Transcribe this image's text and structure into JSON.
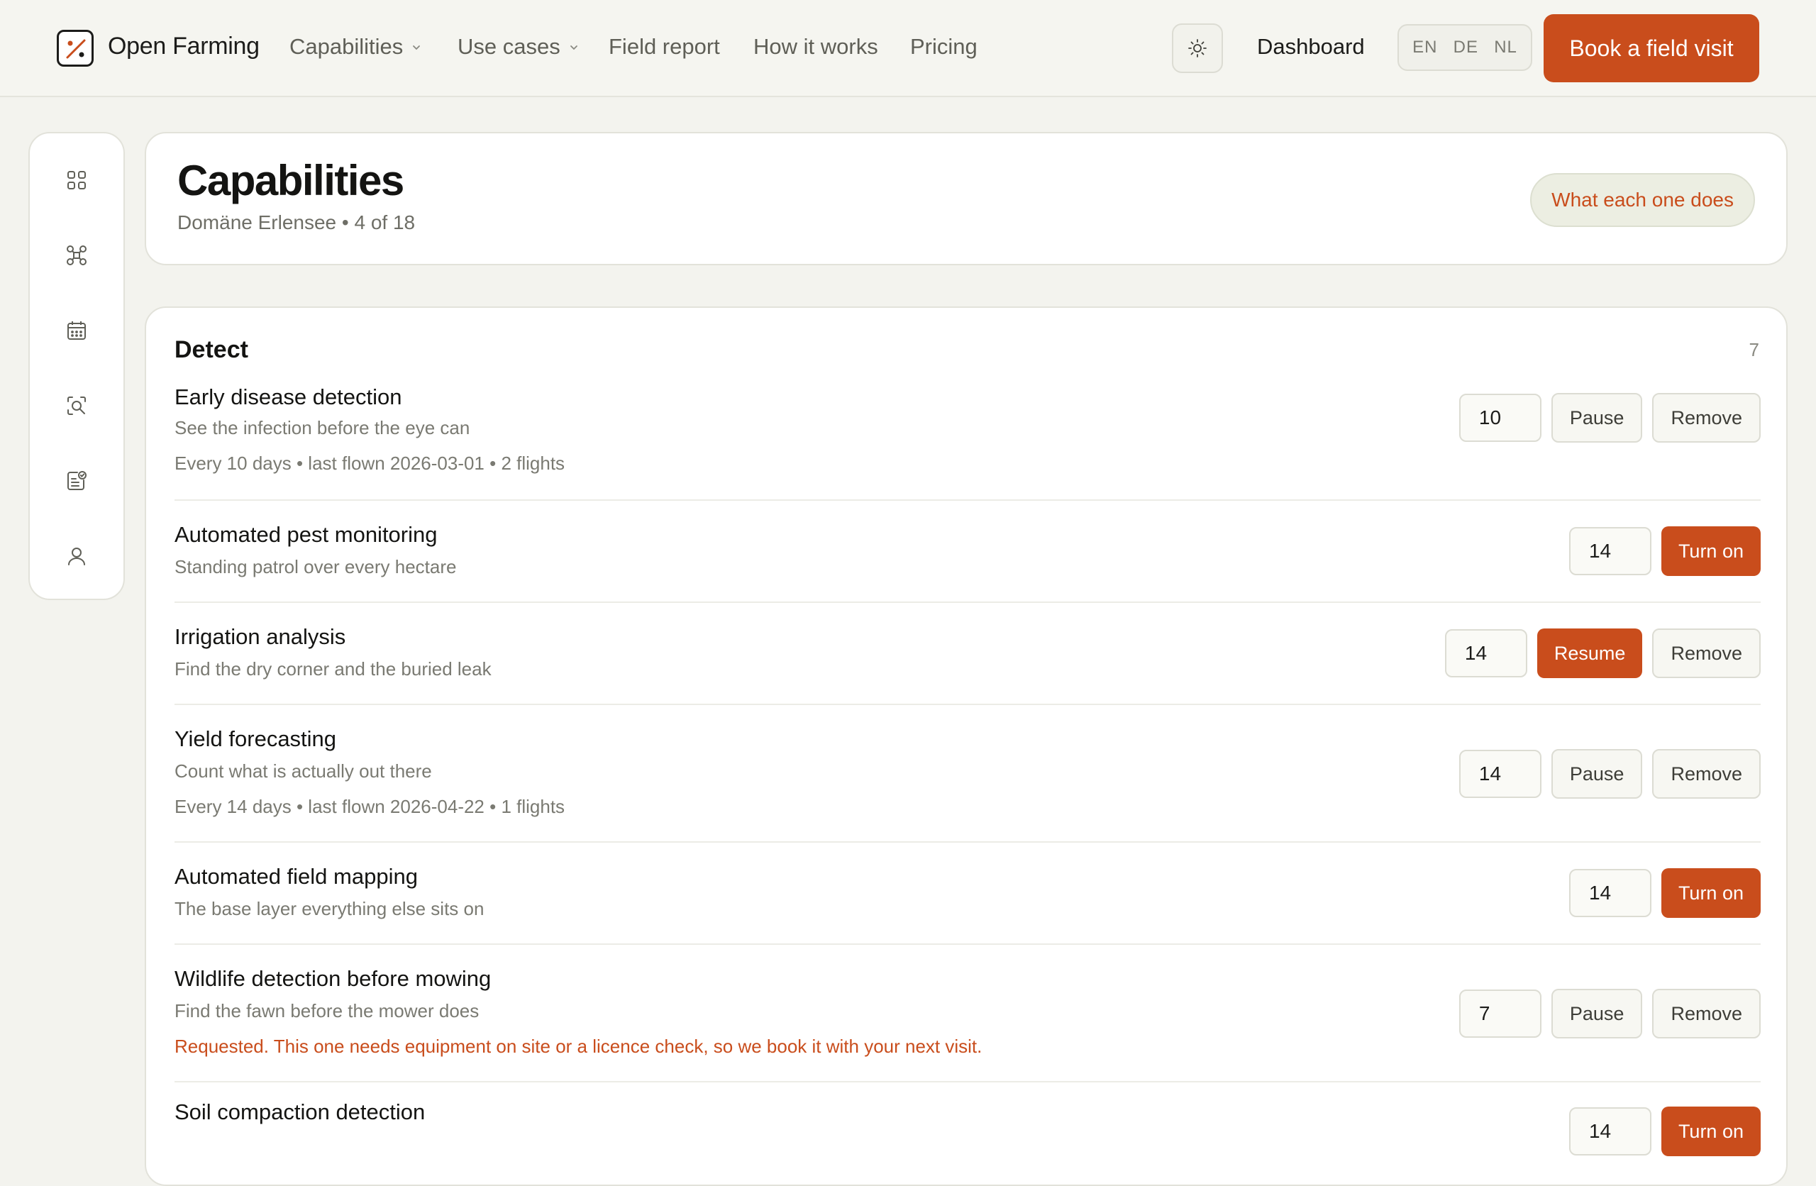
{
  "header": {
    "brand": "Open Farming",
    "nav": [
      {
        "label": "Capabilities",
        "has_dropdown": true
      },
      {
        "label": "Use cases",
        "has_dropdown": true
      },
      {
        "label": "Field report",
        "has_dropdown": false
      },
      {
        "label": "How it works",
        "has_dropdown": false
      },
      {
        "label": "Pricing",
        "has_dropdown": false
      }
    ],
    "theme_icon": "sun-icon",
    "dashboard": "Dashboard",
    "languages": [
      "EN",
      "DE",
      "NL"
    ],
    "cta": "Book a field visit"
  },
  "sidebar": {
    "icons": [
      "grid-icon",
      "drone-icon",
      "calendar-icon",
      "scan-search-icon",
      "checklist-icon",
      "user-icon"
    ]
  },
  "page": {
    "title": "Capabilities",
    "subtitle": "Domäne Erlensee • 4 of 18",
    "help_button": "What each one does"
  },
  "section": {
    "title": "Detect",
    "count": "7",
    "rows": [
      {
        "title": "Early disease detection",
        "desc": "See the infection before the eye can",
        "meta": "Every 10 days • last flown 2026-03-01 • 2 flights",
        "interval": "10",
        "primary": "Pause",
        "primary_style": "ghost",
        "secondary": "Remove"
      },
      {
        "title": "Automated pest monitoring",
        "desc": "Standing patrol over every hectare",
        "interval": "14",
        "primary": "Turn on",
        "primary_style": "accent"
      },
      {
        "title": "Irrigation analysis",
        "desc": "Find the dry corner and the buried leak",
        "interval": "14",
        "primary": "Resume",
        "primary_style": "accent",
        "secondary": "Remove"
      },
      {
        "title": "Yield forecasting",
        "desc": "Count what is actually out there",
        "meta": "Every 14 days • last flown 2026-04-22 • 1 flights",
        "interval": "14",
        "primary": "Pause",
        "primary_style": "ghost",
        "secondary": "Remove"
      },
      {
        "title": "Automated field mapping",
        "desc": "The base layer everything else sits on",
        "interval": "14",
        "primary": "Turn on",
        "primary_style": "accent"
      },
      {
        "title": "Wildlife detection before mowing",
        "desc": "Find the fawn before the mower does",
        "note": "Requested. This one needs equipment on site or a licence check, so we book it with your next visit.",
        "interval": "7",
        "primary": "Pause",
        "primary_style": "ghost",
        "secondary": "Remove"
      },
      {
        "title": "Soil compaction detection",
        "interval": "14",
        "primary": "Turn on",
        "primary_style": "accent"
      }
    ]
  },
  "colors": {
    "accent": "#c94d1c",
    "background": "#f3f3ee",
    "card": "#ffffff",
    "text": "#1c1c1a",
    "muted": "#7a7a72"
  }
}
